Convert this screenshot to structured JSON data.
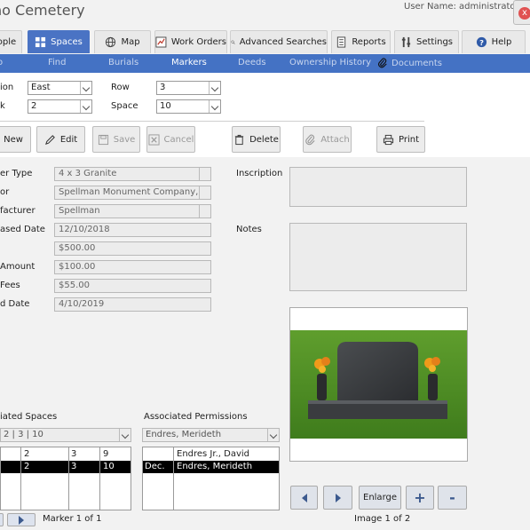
{
  "window": {
    "title": "no Cemetery",
    "user_label": "User Name: administrator",
    "close_glyph": "x"
  },
  "tabs": [
    {
      "label": "ople",
      "icon": "people-icon"
    },
    {
      "label": "Spaces",
      "icon": "grid-icon",
      "active": true
    },
    {
      "label": "Map",
      "icon": "globe-icon"
    },
    {
      "label": "Work Orders",
      "icon": "chart-icon"
    },
    {
      "label": "Advanced Searches",
      "icon": "search-icon"
    },
    {
      "label": "Reports",
      "icon": "document-icon"
    },
    {
      "label": "Settings",
      "icon": "tools-icon"
    },
    {
      "label": "Help",
      "icon": "help-icon"
    }
  ],
  "subnav": [
    {
      "label": "o"
    },
    {
      "label": "Find"
    },
    {
      "label": "Burials"
    },
    {
      "label": "Markers",
      "active": true
    },
    {
      "label": "Deeds"
    },
    {
      "label": "Ownership History"
    },
    {
      "label": "Documents",
      "icon": "paperclip-icon"
    }
  ],
  "location": {
    "section_label": "ion",
    "section_value": "East",
    "row_label": "Row",
    "row_value": "3",
    "block_label": "k",
    "block_value": "2",
    "space_label": "Space",
    "space_value": "10"
  },
  "toolbar": {
    "new": "New",
    "edit": "Edit",
    "save": "Save",
    "cancel": "Cancel",
    "delete": "Delete",
    "attach": "Attach",
    "print": "Print"
  },
  "marker": {
    "type_label": "er Type",
    "type_value": "4 x 3 Granite",
    "vendor_label": "or",
    "vendor_value": "Spellman Monument Company, In",
    "manufacturer_label": "facturer",
    "manufacturer_value": "Spellman",
    "purchased_label": "ased Date",
    "purchased_value": "12/10/2018",
    "price_value": "$500.00",
    "amount_label": "Amount",
    "amount_value": "$100.00",
    "fees_label": "Fees",
    "fees_value": "$55.00",
    "installed_label": "d Date",
    "installed_value": "4/10/2019",
    "inscription_label": "Inscription",
    "notes_label": "Notes"
  },
  "associated_spaces": {
    "label": "iated Spaces",
    "combo_value": "2 | 3 | 10",
    "rows": [
      {
        "c1": "",
        "c2": "2",
        "c3": "3",
        "c4": "9",
        "selected": false
      },
      {
        "c1": "",
        "c2": "2",
        "c3": "3",
        "c4": "10",
        "selected": true
      }
    ]
  },
  "associated_permissions": {
    "label": "Associated Permissions",
    "combo_value": "Endres, Merideth",
    "rows": [
      {
        "c1": "",
        "c2": "Endres Jr., David",
        "selected": false
      },
      {
        "c1": "Dec.",
        "c2": "Endres, Merideth",
        "selected": true
      }
    ]
  },
  "record_nav": {
    "text": "Marker 1 of 1"
  },
  "image_viewer": {
    "enlarge": "Enlarge",
    "plus": "+",
    "minus": "-",
    "counter": "Image 1 of 2"
  },
  "colors": {
    "accent": "#4472c4",
    "tab_active": "#4a73c4",
    "background": "#f2f2f2"
  }
}
